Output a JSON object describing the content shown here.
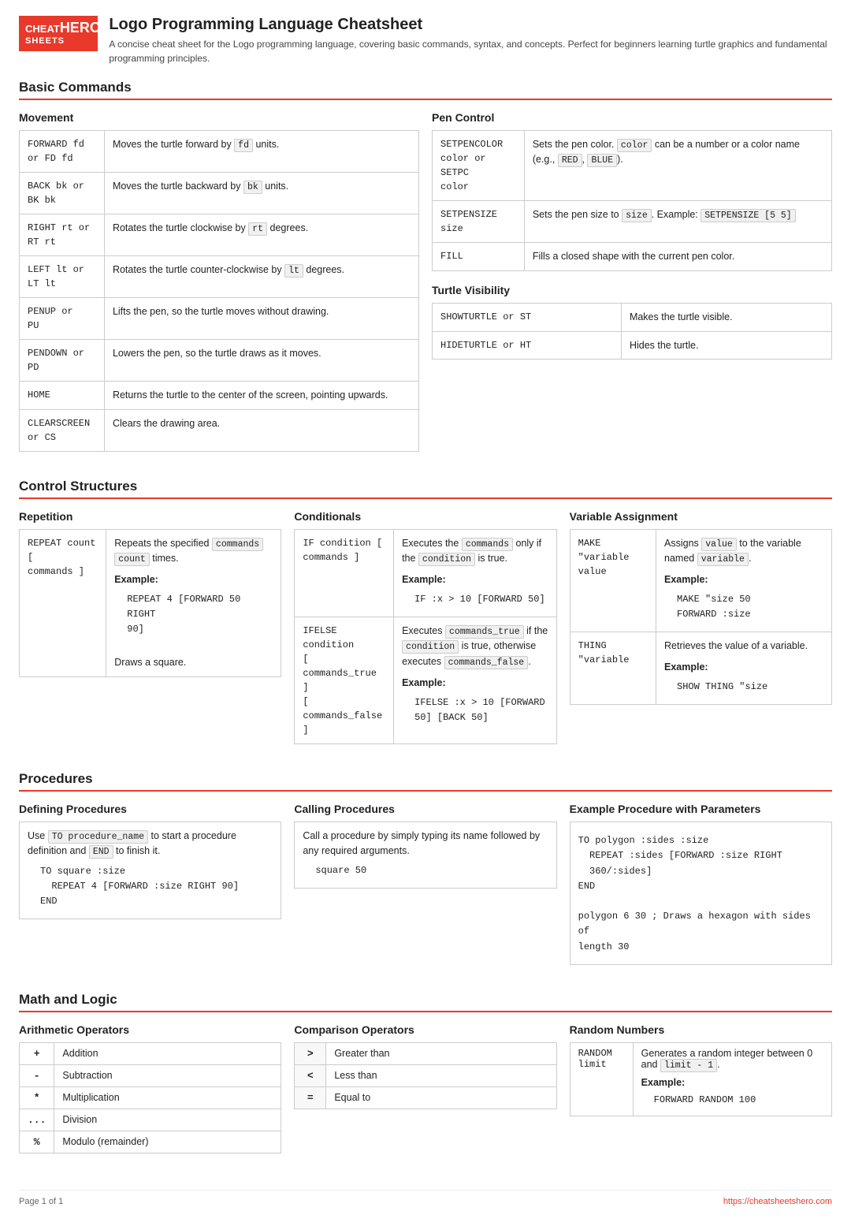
{
  "header": {
    "logo_line1": "CHEAT",
    "logo_line2": "SHEETS",
    "logo_hero": "HERO",
    "title": "Logo Programming Language Cheatsheet",
    "description": "A concise cheat sheet for the Logo programming language, covering basic commands, syntax, and concepts. Perfect for beginners learning turtle graphics and fundamental programming principles."
  },
  "sections": {
    "basic_commands": "Basic Commands",
    "control_structures": "Control Structures",
    "procedures": "Procedures",
    "math_logic": "Math and Logic"
  },
  "movement": {
    "title": "Movement",
    "rows": [
      {
        "cmd": "FORWARD fd\nor FD fd",
        "desc_parts": [
          "Moves the turtle forward by ",
          "fd",
          " units."
        ]
      },
      {
        "cmd": "BACK bk or\nBK bk",
        "desc_parts": [
          "Moves the turtle backward by ",
          "bk",
          " units."
        ]
      },
      {
        "cmd": "RIGHT rt or\nRT rt",
        "desc_parts": [
          "Rotates the turtle clockwise by ",
          "rt",
          " degrees."
        ]
      },
      {
        "cmd": "LEFT lt or\nLT lt",
        "desc_parts": [
          "Rotates the turtle counter-clockwise by ",
          "lt",
          " degrees."
        ]
      },
      {
        "cmd": "PENUP or\nPU",
        "desc_parts": [
          "Lifts the pen, so the turtle moves without drawing."
        ]
      },
      {
        "cmd": "PENDOWN or\nPD",
        "desc_parts": [
          "Lowers the pen, so the turtle draws as it moves."
        ]
      },
      {
        "cmd": "HOME",
        "desc_parts": [
          "Returns the turtle to the center of the screen, pointing upwards."
        ]
      },
      {
        "cmd": "CLEARSCREEN\nor CS",
        "desc_parts": [
          "Clears the drawing area."
        ]
      }
    ]
  },
  "pen_control": {
    "title": "Pen Control",
    "rows": [
      {
        "cmd": "SETPENCOLOR\ncolor or SETPC\ncolor",
        "desc_parts": [
          "Sets the pen color. ",
          "color",
          " can be a number or a color name (e.g., ",
          "RED",
          ", ",
          "BLUE",
          ")."
        ]
      },
      {
        "cmd": "SETPENSIZE\nsize",
        "desc_parts": [
          "Sets the pen size to ",
          "size",
          ". Example: ",
          "SETPENSIZE [5 5]"
        ]
      },
      {
        "cmd": "FILL",
        "desc_parts": [
          "Fills a closed shape with the current pen color."
        ]
      }
    ]
  },
  "turtle_visibility": {
    "title": "Turtle Visibility",
    "rows": [
      {
        "cmd": "SHOWTURTLE or ST",
        "desc": "Makes the turtle visible."
      },
      {
        "cmd": "HIDETURTLE or HT",
        "desc": "Hides the turtle."
      }
    ]
  },
  "repetition": {
    "title": "Repetition",
    "cmd": "REPEAT count [\ncommands ]",
    "desc_parts": [
      "Repeats the specified ",
      "commands",
      " ",
      "count",
      " times."
    ],
    "example_label": "Example:",
    "example_code": "REPEAT 4 [FORWARD 50 RIGHT\n90]",
    "example_note": "Draws a square."
  },
  "conditionals": {
    "title": "Conditionals",
    "rows": [
      {
        "cmd": "IF condition [\ncommands ]",
        "desc_parts": [
          "Executes the ",
          "commands",
          " only if the ",
          "condition",
          " is true."
        ],
        "example_label": "Example:",
        "example_code": "IF :x > 10 [FORWARD 50]"
      },
      {
        "cmd": "IFELSE condition\n[ commands_true ]\n[ commands_false\n]",
        "desc_parts": [
          "Executes ",
          "commands_true",
          " if the ",
          "condition",
          " is true, otherwise executes ",
          "commands_false",
          "."
        ],
        "example_label": "Example:",
        "example_code": "IFELSE :x > 10 [FORWARD\n50] [BACK 50]"
      }
    ]
  },
  "variable_assignment": {
    "title": "Variable Assignment",
    "rows": [
      {
        "cmd": "MAKE \"variable\nvalue",
        "desc_parts": [
          "Assigns ",
          "value",
          " to the variable named ",
          "variable",
          "."
        ],
        "example_label": "Example:",
        "example_code": "MAKE \"size 50\nFORWARD :size"
      },
      {
        "cmd": "THING\n\"variable",
        "desc_parts": [
          "Retrieves the value of a variable."
        ],
        "example_label": "Example:",
        "example_code": "SHOW THING \"size"
      }
    ]
  },
  "defining_procedures": {
    "title": "Defining Procedures",
    "desc_parts": [
      "Use ",
      "TO procedure_name",
      " to start a procedure definition and ",
      "END",
      " to finish it."
    ],
    "example_code": "TO square :size\n  REPEAT 4 [FORWARD :size RIGHT 90]\nEND"
  },
  "calling_procedures": {
    "title": "Calling Procedures",
    "desc": "Call a procedure by simply typing its name followed by any required arguments.",
    "example_code": "square 50"
  },
  "example_procedure": {
    "title": "Example Procedure with Parameters",
    "code": "TO polygon :sides :size\n  REPEAT :sides [FORWARD :size RIGHT\n  360/:sides]\nEND\n\npolygon 6 30 ; Draws a hexagon with sides of\nlength 30"
  },
  "arithmetic": {
    "title": "Arithmetic Operators",
    "rows": [
      {
        "op": "+",
        "desc": "Addition"
      },
      {
        "op": "-",
        "desc": "Subtraction"
      },
      {
        "op": "*",
        "desc": "Multiplication"
      },
      {
        "op": "...",
        "desc": "Division"
      },
      {
        "op": "%",
        "desc": "Modulo (remainder)"
      }
    ]
  },
  "comparison": {
    "title": "Comparison Operators",
    "rows": [
      {
        "op": ">",
        "desc": "Greater than"
      },
      {
        "op": "<",
        "desc": "Less than"
      },
      {
        "op": "=",
        "desc": "Equal to"
      }
    ]
  },
  "random_numbers": {
    "title": "Random Numbers",
    "cmd": "RANDOM\nlimit",
    "desc_parts": [
      "Generates a random integer between 0 and ",
      "limit - 1",
      "."
    ],
    "example_label": "Example:",
    "example_code": "FORWARD RANDOM 100"
  },
  "footer": {
    "page": "Page 1 of 1",
    "url": "https://cheatsheetshero.com"
  }
}
